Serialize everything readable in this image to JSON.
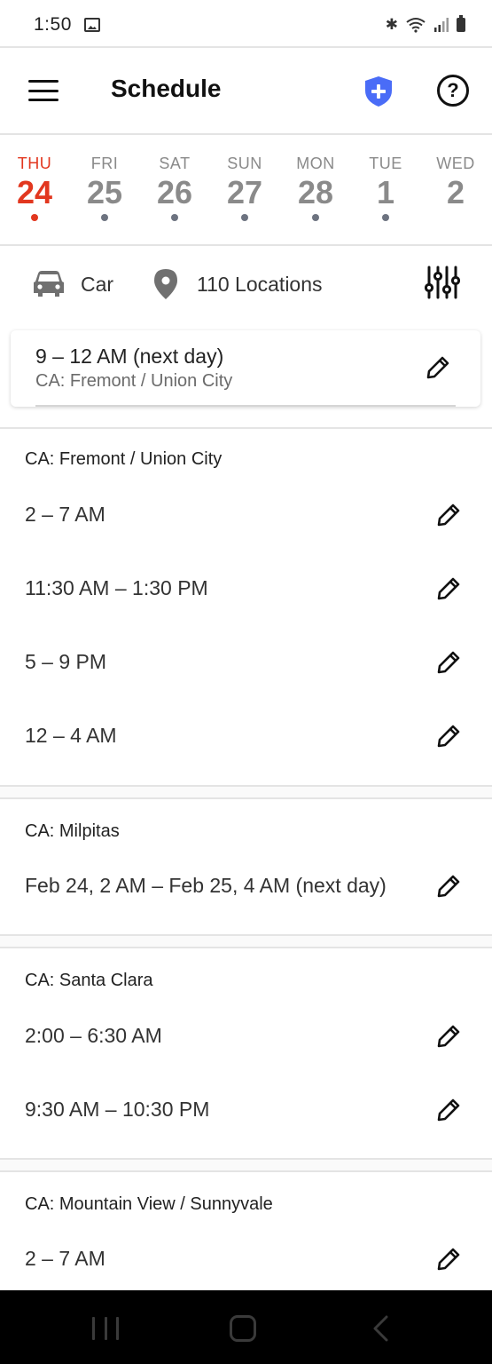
{
  "status_bar": {
    "time": "1:50",
    "icons": [
      "gallery-icon",
      "bluetooth-icon",
      "wifi-icon",
      "signal-icon",
      "battery-icon"
    ]
  },
  "app_bar": {
    "title": "Schedule",
    "icons": [
      "menu-icon",
      "shield-plus-icon",
      "help-icon"
    ],
    "shield_color": "#4a6cf7"
  },
  "date_strip": {
    "accent_color": "#e2371f",
    "days": [
      {
        "dow": "THU",
        "num": "24",
        "active": true
      },
      {
        "dow": "FRI",
        "num": "25",
        "active": false
      },
      {
        "dow": "SAT",
        "num": "26",
        "active": false
      },
      {
        "dow": "SUN",
        "num": "27",
        "active": false
      },
      {
        "dow": "MON",
        "num": "28",
        "active": false
      },
      {
        "dow": "TUE",
        "num": "1",
        "active": false
      },
      {
        "dow": "WED",
        "num": "2",
        "active": false
      }
    ]
  },
  "filters": {
    "vehicle": "Car",
    "locations": "110 Locations",
    "icons": [
      "car-icon",
      "location-pin-icon",
      "sliders-icon"
    ]
  },
  "current_block": {
    "time": "9 – 12 AM (next day)",
    "location": "CA: Fremont / Union City"
  },
  "groups": [
    {
      "title": "CA: Fremont / Union City",
      "blocks": [
        "2 – 7 AM",
        "11:30 AM – 1:30 PM",
        "5 – 9 PM",
        "12 – 4 AM"
      ]
    },
    {
      "title": "CA: Milpitas",
      "blocks": [
        "Feb 24, 2 AM – Feb 25, 4 AM (next day)"
      ]
    },
    {
      "title": "CA: Santa Clara",
      "blocks": [
        "2:00 – 6:30 AM",
        "9:30 AM – 10:30 PM"
      ]
    },
    {
      "title": "CA: Mountain View / Sunnyvale",
      "blocks": [
        "2 – 7 AM"
      ]
    }
  ],
  "nav_bar": {
    "icons": [
      "recents-icon",
      "home-icon",
      "back-icon"
    ]
  }
}
